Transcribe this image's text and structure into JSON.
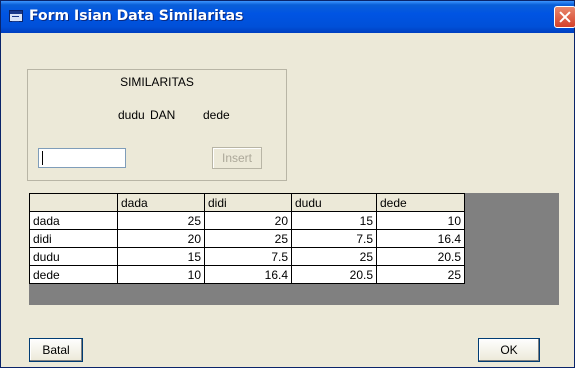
{
  "window": {
    "title": "Form Isian Data Similaritas"
  },
  "similarity": {
    "group_title": "SIMILARITAS",
    "left_item": "dudu",
    "connector": "DAN",
    "right_item": "dede",
    "input_value": "",
    "insert_label": "Insert"
  },
  "table": {
    "columns": [
      "",
      "dada",
      "didi",
      "dudu",
      "dede"
    ],
    "rows": [
      {
        "label": "dada",
        "values": [
          "25",
          "20",
          "15",
          "10"
        ]
      },
      {
        "label": "didi",
        "values": [
          "20",
          "25",
          "7.5",
          "16.4"
        ]
      },
      {
        "label": "dudu",
        "values": [
          "15",
          "7.5",
          "25",
          "20.5"
        ]
      },
      {
        "label": "dede",
        "values": [
          "10",
          "16.4",
          "20.5",
          "25"
        ]
      }
    ]
  },
  "buttons": {
    "batal": "Batal",
    "ok": "OK"
  },
  "colors": {
    "titlebar": "#0054e3",
    "close": "#d5412a",
    "face": "#ece9d8",
    "grid_bg": "#808080"
  },
  "icons": {
    "window_icon": "form-window-icon",
    "close_icon": "close-icon"
  }
}
